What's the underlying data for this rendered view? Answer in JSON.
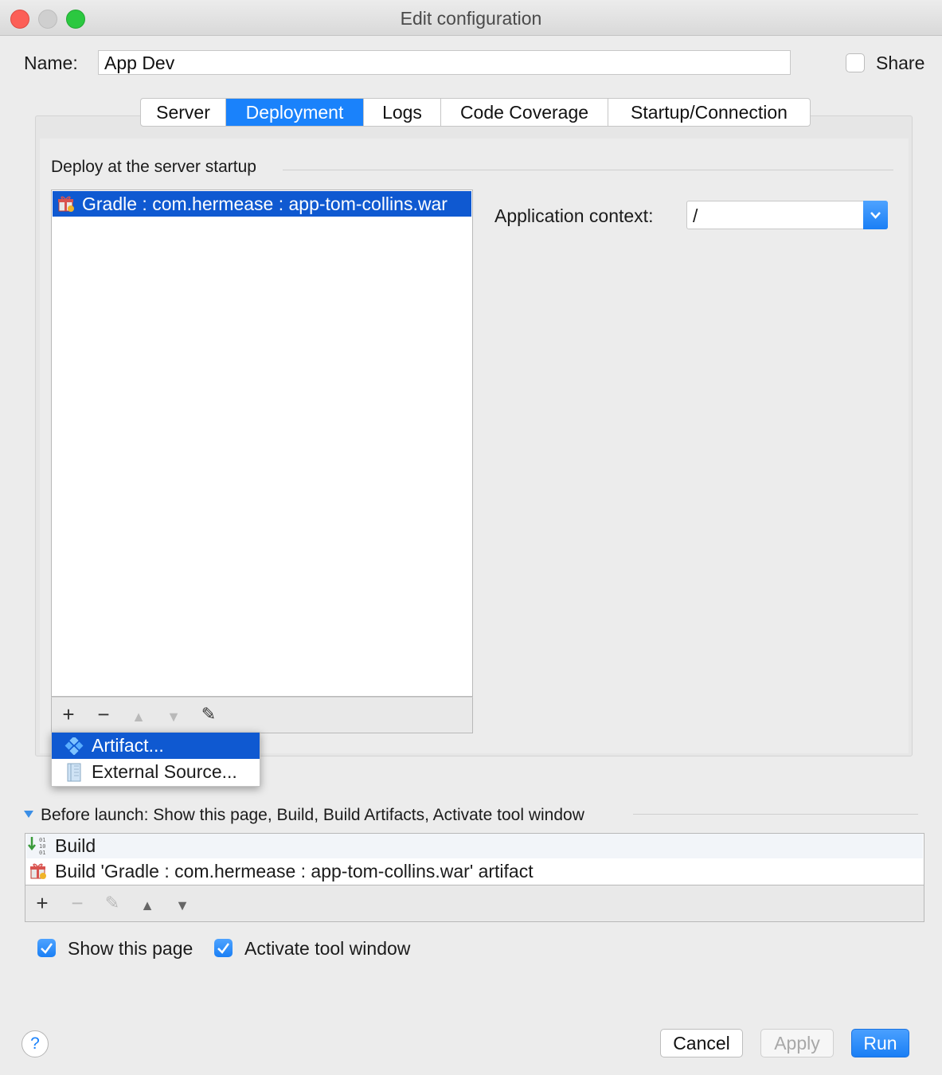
{
  "window": {
    "title": "Edit configuration"
  },
  "name_row": {
    "label": "Name:",
    "value": "App Dev",
    "share_label": "Share",
    "share_checked": false
  },
  "tabs": [
    {
      "label": "Server",
      "active": false
    },
    {
      "label": "Deployment",
      "active": true
    },
    {
      "label": "Logs",
      "active": false
    },
    {
      "label": "Code Coverage",
      "active": false
    },
    {
      "label": "Startup/Connection",
      "active": false
    }
  ],
  "deployment": {
    "section_label": "Deploy at the server startup",
    "items": [
      {
        "label": "Gradle : com.hermease : app-tom-collins.war",
        "icon": "artifact-gift-icon",
        "selected": true
      }
    ],
    "toolbar": {
      "add": "+",
      "remove": "−",
      "up": "▲",
      "down": "▼",
      "edit": "✎"
    },
    "app_context_label": "Application context:",
    "app_context_value": "/"
  },
  "popup_menu": {
    "items": [
      {
        "label": "Artifact...",
        "icon": "artifact-icon",
        "selected": true
      },
      {
        "label": "External Source...",
        "icon": "external-source-icon",
        "selected": false
      }
    ]
  },
  "before_launch": {
    "label": "Before launch: Show this page, Build, Build Artifacts, Activate tool window",
    "items": [
      {
        "label": "Build",
        "icon": "build-icon"
      },
      {
        "label": "Build 'Gradle : com.hermease : app-tom-collins.war' artifact",
        "icon": "artifact-gift-icon"
      }
    ],
    "toolbar": {
      "add": "+",
      "remove": "−",
      "edit": "✎",
      "up": "▲",
      "down": "▼"
    }
  },
  "options": {
    "show_this_page": {
      "label": "Show this page",
      "checked": true
    },
    "activate_tool_window": {
      "label": "Activate tool window",
      "checked": true
    }
  },
  "buttons": {
    "help": "?",
    "cancel": "Cancel",
    "apply": "Apply",
    "run": "Run"
  },
  "colors": {
    "accent": "#1a82fb",
    "selection": "#0f59d1"
  }
}
